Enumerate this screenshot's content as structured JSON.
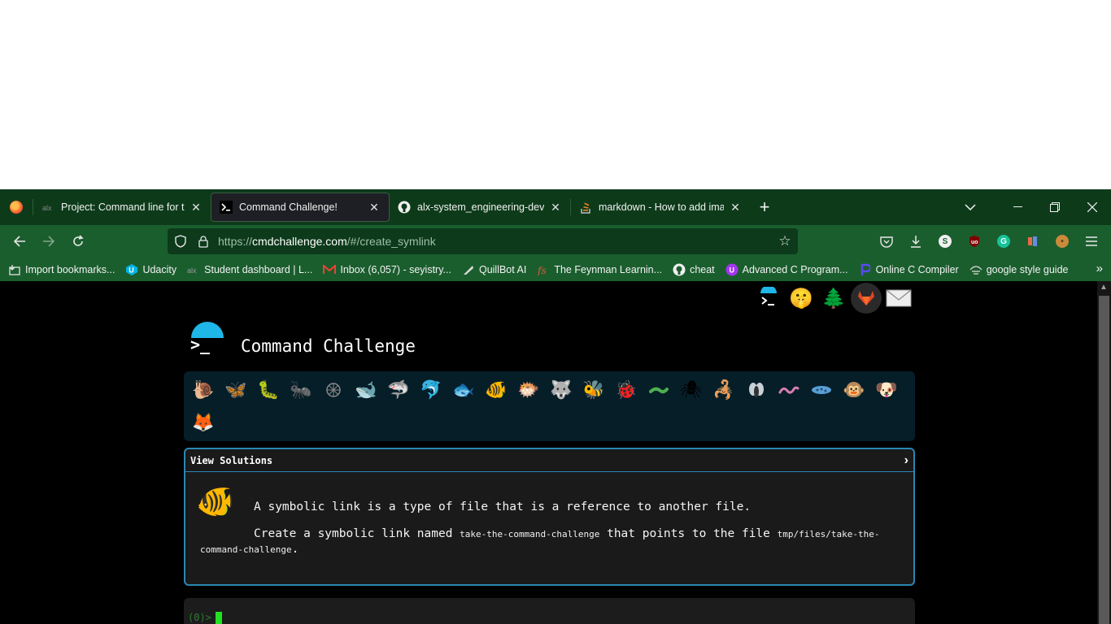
{
  "tabs": [
    {
      "title": "Project: Command line for the v",
      "icon": "alx-icon",
      "active": false
    },
    {
      "title": "Command Challenge!",
      "icon": "terminal-icon",
      "active": true
    },
    {
      "title": "alx-system_engineering-devops",
      "icon": "github-icon",
      "active": false
    },
    {
      "title": "markdown - How to add image",
      "icon": "stackoverflow-icon",
      "active": false
    }
  ],
  "navbar": {
    "url_prefix": "https://",
    "url_host": "cmdchallenge.com",
    "url_path": "/#/create_symlink"
  },
  "bookmarks": [
    {
      "label": "Import bookmarks...",
      "icon": "import-icon"
    },
    {
      "label": "Udacity",
      "icon": "udacity-icon"
    },
    {
      "label": "Student dashboard | L...",
      "icon": "alx-icon"
    },
    {
      "label": "Inbox (6,057) - seyistry...",
      "icon": "gmail-icon"
    },
    {
      "label": "QuillBot AI",
      "icon": "quill-icon"
    },
    {
      "label": "The Feynman Learnin...",
      "icon": "fs-icon"
    },
    {
      "label": "cheat",
      "icon": "github-icon"
    },
    {
      "label": "Advanced C Program...",
      "icon": "udemy-icon"
    },
    {
      "label": "Online C Compiler",
      "icon": "compiler-icon"
    },
    {
      "label": "google style guide",
      "icon": "eye-icon"
    }
  ],
  "page": {
    "title": "Command Challenge",
    "logo_glyph": ">_",
    "panel_header": "View Solutions",
    "description_1": "A symbolic link is a type of file that is a reference to another file.",
    "desc2_before": "Create a symbolic link named",
    "desc2_code1": "take-the-command-challenge",
    "desc2_middle": "that points to the file",
    "desc2_code2": "tmp/files/take-the-command-challenge",
    "desc2_after": ".",
    "prompt": "(0)>"
  },
  "levels": [
    "snail",
    "butterfly",
    "caterpillar",
    "ant",
    "jellyfish",
    "whale",
    "shark",
    "dolphin",
    "fish",
    "tropical-fish",
    "pufferfish",
    "wolf",
    "bee",
    "ladybug",
    "worm",
    "spider",
    "scorpion",
    "fly",
    "earthworm",
    "bacteria",
    "monkey",
    "dog",
    "fox"
  ],
  "colors": {
    "tabstrip": "#0d3b1a",
    "navbar": "#1b5e2e",
    "accent": "#1fb6e8",
    "panel_border": "#2b86b3",
    "cursor": "#22e022"
  }
}
